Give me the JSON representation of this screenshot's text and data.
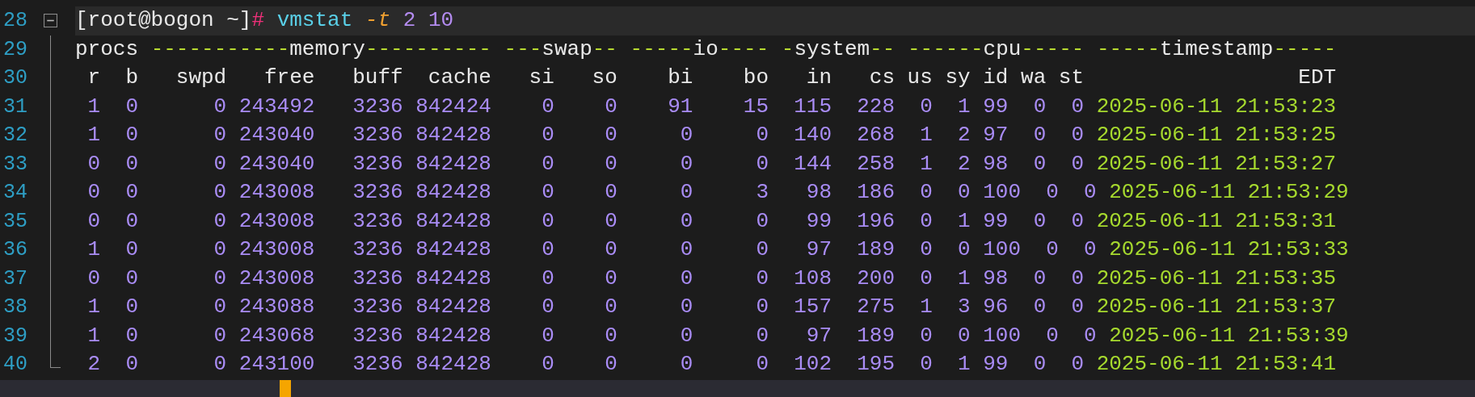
{
  "editor": {
    "fold_expanded": true,
    "lines": [
      {
        "number": "28",
        "kind": "prompt",
        "current": true,
        "segments": [
          {
            "kind": "prompt",
            "text": "[root@bogon ~]"
          },
          {
            "kind": "symbol",
            "text": "#"
          },
          {
            "kind": "command",
            "text": "vmstat"
          },
          {
            "kind": "option",
            "text": "-t"
          },
          {
            "kind": "argument",
            "text": "2 10"
          }
        ]
      },
      {
        "number": "29",
        "kind": "header",
        "current": false,
        "text": "procs -----------memory---------- ---swap-- -----io---- -system-- ------cpu----- -----timestamp-----"
      },
      {
        "number": "30",
        "kind": "columns",
        "current": false,
        "cells": [
          "r",
          "b",
          "swpd",
          "free",
          "buff",
          "cache",
          "si",
          "so",
          "bi",
          "bo",
          "in",
          "cs",
          "us",
          "sy",
          "id",
          "wa",
          "st",
          "EDT"
        ]
      },
      {
        "number": "31",
        "kind": "data",
        "current": false,
        "cells": [
          "1",
          "0",
          "0",
          "243492",
          "3236",
          "842424",
          "0",
          "0",
          "91",
          "15",
          "115",
          "228",
          "0",
          "1",
          "99",
          "0",
          "0"
        ],
        "timestamp": "2025-06-11 21:53:23"
      },
      {
        "number": "32",
        "kind": "data",
        "current": false,
        "cells": [
          "1",
          "0",
          "0",
          "243040",
          "3236",
          "842428",
          "0",
          "0",
          "0",
          "0",
          "140",
          "268",
          "1",
          "2",
          "97",
          "0",
          "0"
        ],
        "timestamp": "2025-06-11 21:53:25"
      },
      {
        "number": "33",
        "kind": "data",
        "current": false,
        "cells": [
          "0",
          "0",
          "0",
          "243040",
          "3236",
          "842428",
          "0",
          "0",
          "0",
          "0",
          "144",
          "258",
          "1",
          "2",
          "98",
          "0",
          "0"
        ],
        "timestamp": "2025-06-11 21:53:27"
      },
      {
        "number": "34",
        "kind": "data",
        "current": false,
        "cells": [
          "0",
          "0",
          "0",
          "243008",
          "3236",
          "842428",
          "0",
          "0",
          "0",
          "3",
          "98",
          "186",
          "0",
          "0",
          "100",
          "0",
          "0"
        ],
        "timestamp": "2025-06-11 21:53:29"
      },
      {
        "number": "35",
        "kind": "data",
        "current": false,
        "cells": [
          "0",
          "0",
          "0",
          "243008",
          "3236",
          "842428",
          "0",
          "0",
          "0",
          "0",
          "99",
          "196",
          "0",
          "1",
          "99",
          "0",
          "0"
        ],
        "timestamp": "2025-06-11 21:53:31"
      },
      {
        "number": "36",
        "kind": "data",
        "current": false,
        "cells": [
          "1",
          "0",
          "0",
          "243008",
          "3236",
          "842428",
          "0",
          "0",
          "0",
          "0",
          "97",
          "189",
          "0",
          "0",
          "100",
          "0",
          "0"
        ],
        "timestamp": "2025-06-11 21:53:33"
      },
      {
        "number": "37",
        "kind": "data",
        "current": false,
        "cells": [
          "0",
          "0",
          "0",
          "243008",
          "3236",
          "842428",
          "0",
          "0",
          "0",
          "0",
          "108",
          "200",
          "0",
          "1",
          "98",
          "0",
          "0"
        ],
        "timestamp": "2025-06-11 21:53:35"
      },
      {
        "number": "38",
        "kind": "data",
        "current": false,
        "cells": [
          "1",
          "0",
          "0",
          "243088",
          "3236",
          "842428",
          "0",
          "0",
          "0",
          "0",
          "157",
          "275",
          "1",
          "3",
          "96",
          "0",
          "0"
        ],
        "timestamp": "2025-06-11 21:53:37"
      },
      {
        "number": "39",
        "kind": "data",
        "current": false,
        "cells": [
          "1",
          "0",
          "0",
          "243068",
          "3236",
          "842428",
          "0",
          "0",
          "0",
          "0",
          "97",
          "189",
          "0",
          "0",
          "100",
          "0",
          "0"
        ],
        "timestamp": "2025-06-11 21:53:39"
      },
      {
        "number": "40",
        "kind": "data",
        "current": false,
        "cells": [
          "2",
          "0",
          "0",
          "243100",
          "3236",
          "842428",
          "0",
          "0",
          "0",
          "0",
          "102",
          "195",
          "0",
          "1",
          "99",
          "0",
          "0"
        ],
        "timestamp": "2025-06-11 21:53:41"
      }
    ]
  }
}
